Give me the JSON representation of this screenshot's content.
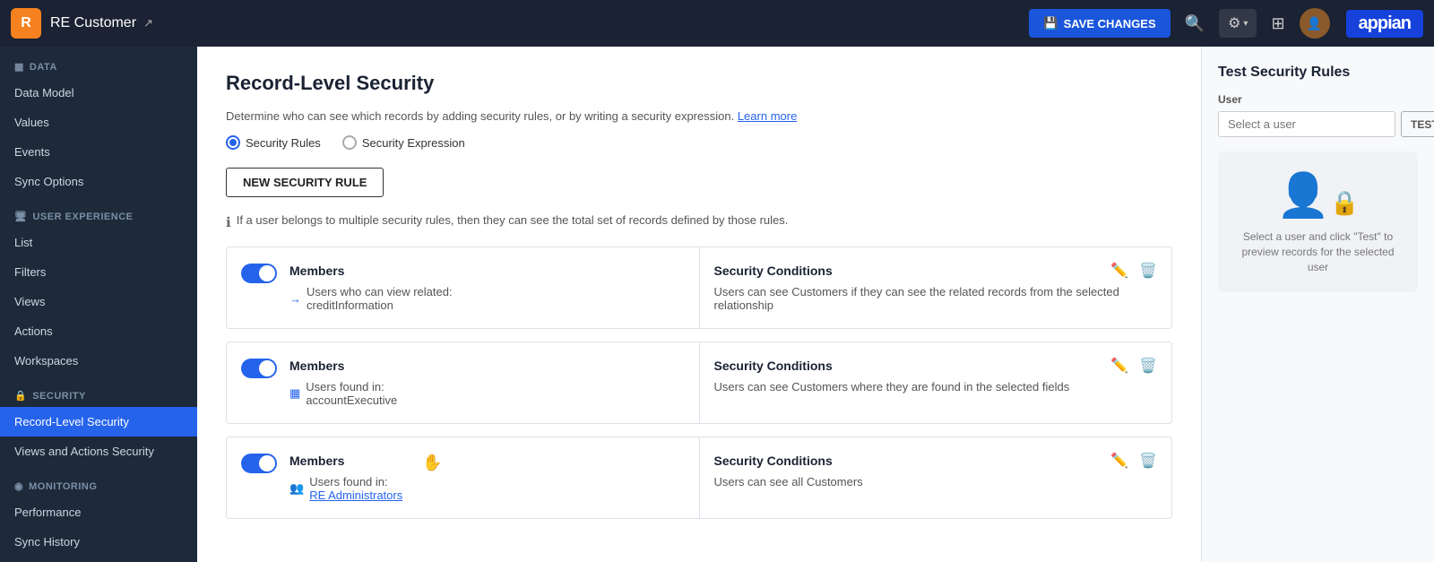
{
  "topnav": {
    "logo_letter": "R",
    "app_name": "RE Customer",
    "ext_icon": "↗",
    "save_label": "SAVE CHANGES",
    "search_icon": "🔍",
    "gear_icon": "⚙",
    "grid_icon": "⊞",
    "appian_label": "appian"
  },
  "sidebar": {
    "sections": [
      {
        "header": "DATA",
        "icon": "▦",
        "items": [
          {
            "label": "Data Model",
            "active": false
          },
          {
            "label": "Values",
            "active": false
          },
          {
            "label": "Events",
            "active": false
          },
          {
            "label": "Sync Options",
            "active": false
          }
        ]
      },
      {
        "header": "USER EXPERIENCE",
        "icon": "🖥",
        "items": [
          {
            "label": "List",
            "active": false
          },
          {
            "label": "Filters",
            "active": false
          },
          {
            "label": "Views",
            "active": false
          },
          {
            "label": "Actions",
            "active": false
          },
          {
            "label": "Workspaces",
            "active": false
          }
        ]
      },
      {
        "header": "SECURITY",
        "icon": "🔒",
        "items": [
          {
            "label": "Record-Level Security",
            "active": true
          },
          {
            "label": "Views and Actions Security",
            "active": false
          }
        ]
      },
      {
        "header": "MONITORING",
        "icon": "◉",
        "items": [
          {
            "label": "Performance",
            "active": false
          },
          {
            "label": "Sync History",
            "active": false
          }
        ]
      }
    ]
  },
  "page": {
    "title": "Record-Level Security",
    "description": "Determine who can see which records by adding security rules, or by writing a security expression.",
    "learn_more": "Learn more",
    "radio_options": [
      {
        "label": "Security Rules",
        "selected": true
      },
      {
        "label": "Security Expression",
        "selected": false
      }
    ],
    "new_rule_btn": "NEW SECURITY RULE",
    "info_text": "If a user belongs to multiple security rules, then they can see the total set of records defined by those rules."
  },
  "rules": [
    {
      "enabled": true,
      "member_label": "Members",
      "member_icon": "→",
      "member_desc": "Users who can view related:",
      "member_link": "creditInformation",
      "cond_label": "Security Conditions",
      "cond_text": "Users can see Customers if they can see the related records from the selected relationship"
    },
    {
      "enabled": true,
      "member_label": "Members",
      "member_icon": "▦",
      "member_desc": "Users found in:",
      "member_link": "accountExecutive",
      "cond_label": "Security Conditions",
      "cond_text": "Users can see Customers where they are found in the selected fields"
    },
    {
      "enabled": true,
      "member_label": "Members",
      "member_icon": "👥",
      "member_desc": "Users found in:",
      "member_link": "RE Administrators",
      "cond_label": "Security Conditions",
      "cond_text": "Users can see all Customers"
    }
  ],
  "right_panel": {
    "title": "Test Security Rules",
    "user_label": "User",
    "user_placeholder": "Select a user",
    "test_btn": "TEST",
    "preview_text": "Select a user and click \"Test\" to preview records for the selected user"
  }
}
